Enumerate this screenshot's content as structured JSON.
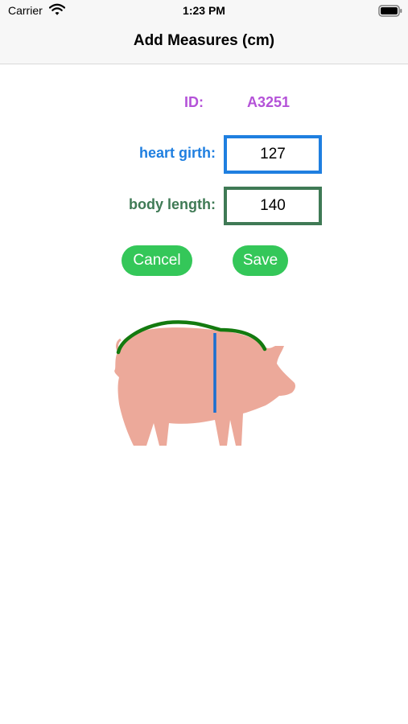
{
  "status_bar": {
    "carrier": "Carrier",
    "time": "1:23 PM",
    "wifi_icon": "wifi-icon",
    "battery_icon": "battery-icon"
  },
  "nav": {
    "title": "Add Measures (cm)"
  },
  "form": {
    "id_label": "ID:",
    "id_value": "A3251",
    "heart_girth_label": "heart girth:",
    "heart_girth_value": "127",
    "body_length_label": "body length:",
    "body_length_value": "140"
  },
  "buttons": {
    "cancel_label": "Cancel",
    "save_label": "Save"
  },
  "colors": {
    "id": "#b452d8",
    "heart_girth": "#1f7fe0",
    "body_length": "#3f7a55",
    "button": "#34c759",
    "pig": "#eca99a",
    "body_length_line": "#137a0f",
    "heart_girth_line": "#1a6fd1"
  },
  "diagram": {
    "icon": "pig-silhouette-icon"
  }
}
